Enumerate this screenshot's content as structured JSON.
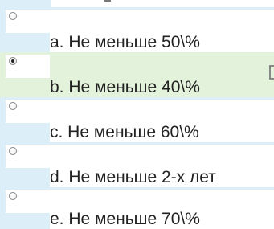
{
  "options": [
    {
      "label": "a. Не меньше 50\\%",
      "selected": false
    },
    {
      "label": "b. Не меньше 40\\%",
      "selected": true
    },
    {
      "label": "c. Не меньше 60\\%",
      "selected": false
    },
    {
      "label": "d. Не меньше 2-х лет",
      "selected": false
    },
    {
      "label": "e. Не меньше 70\\%",
      "selected": false
    }
  ],
  "colors": {
    "row_bg": "#dceef7",
    "selected_row_bg": "#e3f2db",
    "cell_bg": "#ffffff",
    "text": "#222222"
  }
}
